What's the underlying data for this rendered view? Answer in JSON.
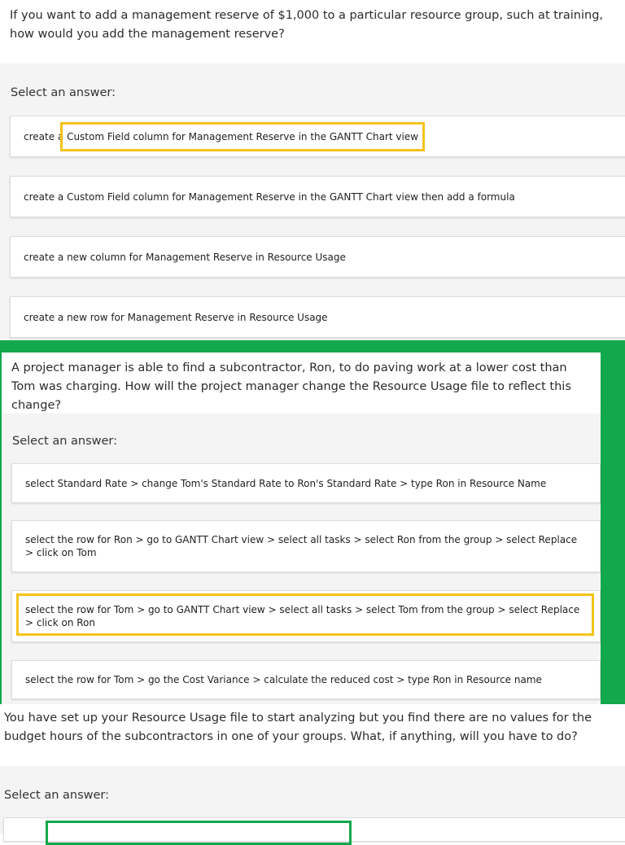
{
  "questions": [
    {
      "text": "If you want to add a management reserve of $1,000 to a particular resource group, such at training, how would you add the management reserve?",
      "select_label": "Select an answer:",
      "answers": [
        "create a Custom Field column for Management Reserve in the GANTT Chart view",
        "create a Custom Field column for Management Reserve in the GANTT Chart view then add a formula",
        "create a new column for Management Reserve in Resource Usage",
        "create a new row for Management Reserve in Resource Usage"
      ]
    },
    {
      "text": "A project manager is able to find a subcontractor, Ron, to do paving work at a lower cost than Tom was charging. How will the project manager change the Resource Usage file to reflect this change?",
      "select_label": "Select an answer:",
      "answers": [
        "select Standard Rate > change Tom's Standard Rate to Ron's Standard Rate > type Ron in Resource Name",
        "select the row for Ron > go to GANTT Chart view > select all tasks > select Ron from the group > select Replace > click on Tom",
        "select the row for Tom > go to GANTT Chart view > select all tasks > select Tom from the group > select Replace > click on Ron",
        "select the row for Tom > go the Cost Variance > calculate the reduced cost > type Ron in Resource name"
      ]
    },
    {
      "text": "You have set up your Resource Usage file to start analyzing but you find there are no values for the budget hours of the subcontractors in one of your groups. What, if anything, will you have to do?",
      "select_label": "Select an answer:"
    }
  ],
  "colors": {
    "highlight_yellow": "#f5c21a",
    "highlight_green": "#12a84b"
  }
}
